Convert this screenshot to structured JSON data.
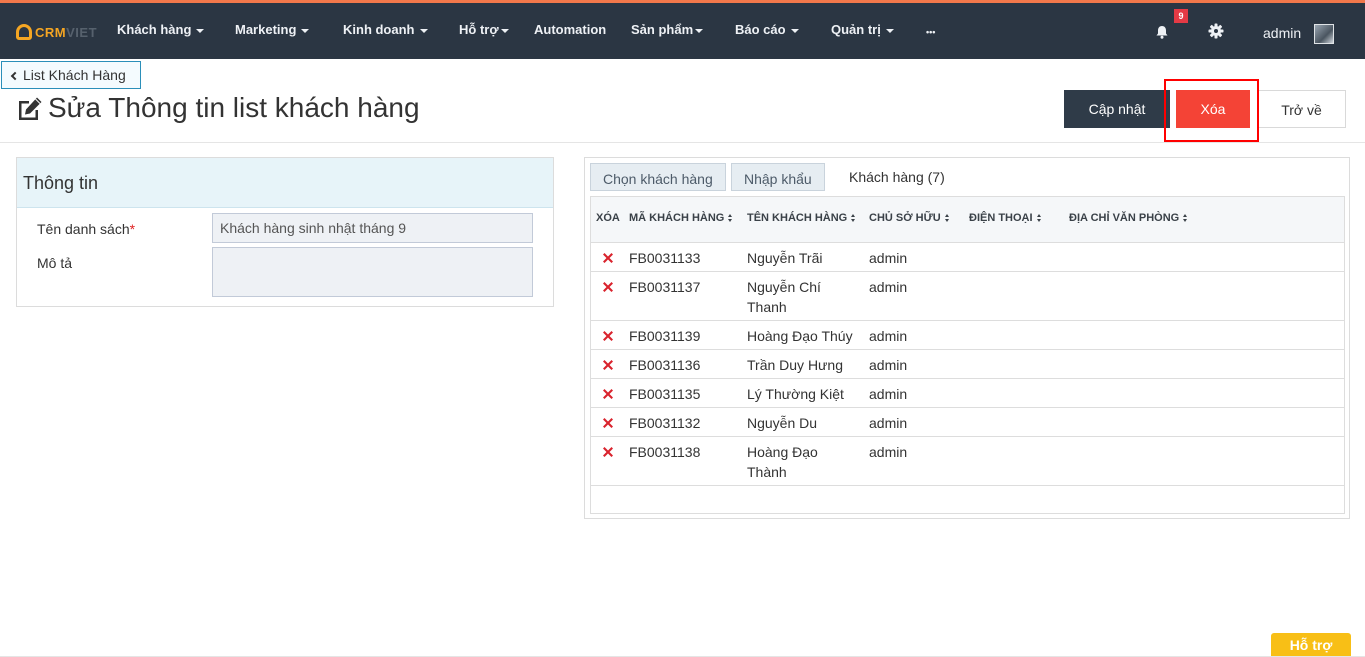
{
  "brand": {
    "text_a": "CRM",
    "text_b": "VIET",
    "accent": "#f5a623",
    "topbar_color": "#2b3643"
  },
  "nav": {
    "items": [
      {
        "label": "Khách hàng",
        "caret": true
      },
      {
        "label": "Marketing",
        "caret": true
      },
      {
        "label": "Kinh doanh",
        "caret": true
      },
      {
        "label": "Hỗ trợ",
        "caret": true
      },
      {
        "label": "Automation",
        "caret": false
      },
      {
        "label": "Sản phẩm",
        "caret": true
      },
      {
        "label": "Báo cáo",
        "caret": true
      },
      {
        "label": "Quản trị",
        "caret": true
      },
      {
        "label": "•••",
        "caret": false
      }
    ],
    "notification_count": "9",
    "user_name": "admin",
    "icons": [
      "bell-icon",
      "gear-icon"
    ]
  },
  "breadcrumb": {
    "back_label": "List Khách Hàng"
  },
  "page": {
    "title": "Sửa Thông tin list khách hàng",
    "title_icon": "edit-icon"
  },
  "actions": {
    "update_label": "Cập nhật",
    "delete_label": "Xóa",
    "back_label": "Trở về",
    "delete_color": "#f44336"
  },
  "info_panel": {
    "heading": "Thông tin",
    "name_label": "Tên danh sách",
    "required_mark": "*",
    "name_value": "Khách hàng sinh nhật tháng 9",
    "desc_label": "Mô tả",
    "desc_value": ""
  },
  "customers_panel": {
    "tabs": {
      "choose": "Chọn khách hàng",
      "import": "Nhập khẩu",
      "active": "Khách hàng (7)"
    },
    "columns": [
      "XÓA",
      "MÃ KHÁCH HÀNG",
      "TÊN KHÁCH HÀNG",
      "CHỦ SỞ HỮU",
      "ĐIỆN THOẠI",
      "ĐỊA CHỈ VĂN PHÒNG"
    ],
    "rows": [
      {
        "code": "FB0031133",
        "name": "Nguyễn Trãi",
        "owner": "admin"
      },
      {
        "code": "FB0031137",
        "name": "Nguyễn Chí Thanh",
        "owner": "admin"
      },
      {
        "code": "FB0031139",
        "name": "Hoàng Đạo Thúy",
        "owner": "admin"
      },
      {
        "code": "FB0031136",
        "name": "Trần Duy Hưng",
        "owner": "admin"
      },
      {
        "code": "FB0031135",
        "name": "Lý Thường Kiệt",
        "owner": "admin"
      },
      {
        "code": "FB0031132",
        "name": "Nguyễn Du",
        "owner": "admin"
      },
      {
        "code": "FB0031138",
        "name": "Hoàng Đạo Thành",
        "owner": "admin"
      }
    ]
  },
  "help": {
    "label": "Hỗ trợ"
  }
}
